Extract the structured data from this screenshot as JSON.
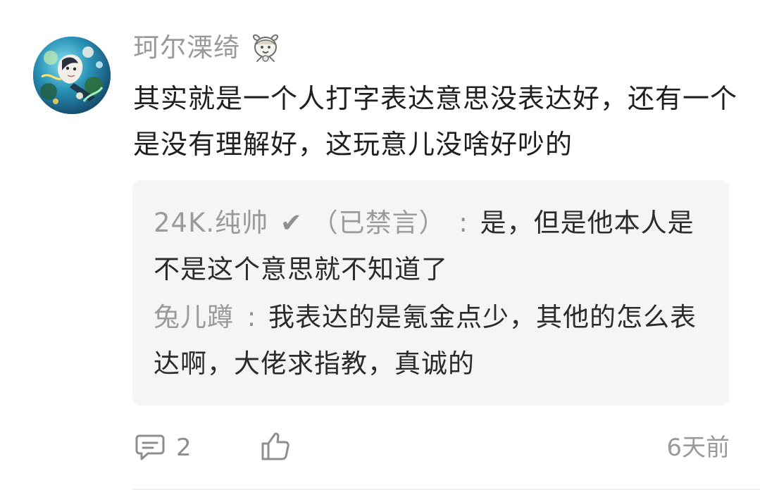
{
  "comment": {
    "author": {
      "name": "珂尔溧绮",
      "avatar_icon": "avatar-image",
      "badge_icon": "chibi-badge-icon"
    },
    "text": "其实就是一个人打字表达意思没表达好，还有一个是没有理解好，这玩意儿没啥好吵的",
    "replies": [
      {
        "author": "24K.纯帅",
        "verified_mark": "✔",
        "suffix": "（已禁言）",
        "separator": ":",
        "text": "是，但是他本人是不是这个意思就不知道了"
      },
      {
        "author": "兔儿蹲",
        "separator": ":",
        "text": "我表达的是氪金点少，其他的怎么表达啊，大佬求指教，真诚的"
      }
    ],
    "footer": {
      "reply_count": "2",
      "time": "6天前",
      "reply_icon": "comment-icon",
      "like_icon": "thumbs-up-icon"
    }
  },
  "colors": {
    "background": "#ffffff",
    "reply_box": "#f5f5f5",
    "text_primary": "#1f1f1f",
    "text_secondary": "#9a9a9a"
  }
}
